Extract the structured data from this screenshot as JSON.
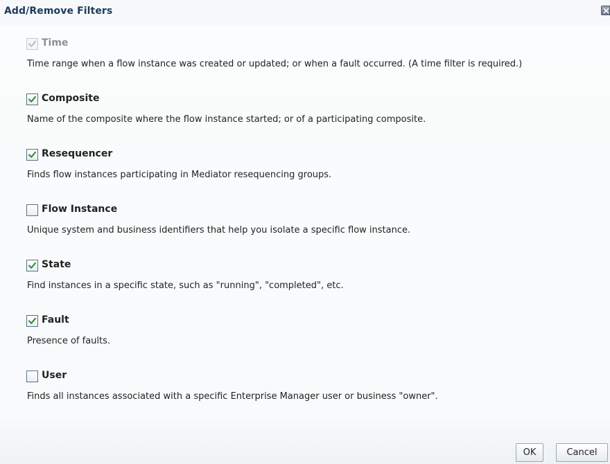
{
  "dialog": {
    "title": "Add/Remove Filters",
    "close_icon": "close-icon"
  },
  "filters": [
    {
      "label": "Time",
      "description": "Time range when a flow instance was created or updated; or when a fault occurred. (A time filter is required.)",
      "checked": true,
      "disabled": true
    },
    {
      "label": "Composite",
      "description": "Name of the composite where the flow instance started; or of a participating composite.",
      "checked": true,
      "disabled": false
    },
    {
      "label": "Resequencer",
      "description": "Finds flow instances participating in Mediator resequencing groups.",
      "checked": true,
      "disabled": false
    },
    {
      "label": "Flow Instance",
      "description": "Unique system and business identifiers that help you isolate a specific flow instance.",
      "checked": false,
      "disabled": false
    },
    {
      "label": "State",
      "description": "Find instances in a specific state, such as \"running\", \"completed\", etc.",
      "checked": true,
      "disabled": false
    },
    {
      "label": "Fault",
      "description": "Presence of faults.",
      "checked": true,
      "disabled": false
    },
    {
      "label": "User",
      "description": "Finds all instances associated with a specific Enterprise Manager user or business \"owner\".",
      "checked": false,
      "disabled": false
    }
  ],
  "buttons": {
    "ok_label": "OK",
    "cancel_label": "Cancel"
  },
  "colors": {
    "title_text": "#1e3a5a",
    "checkmark": "#2e8b2e",
    "checkmark_disabled": "#a9c9a9",
    "checkbox_border": "#5a6f86"
  }
}
